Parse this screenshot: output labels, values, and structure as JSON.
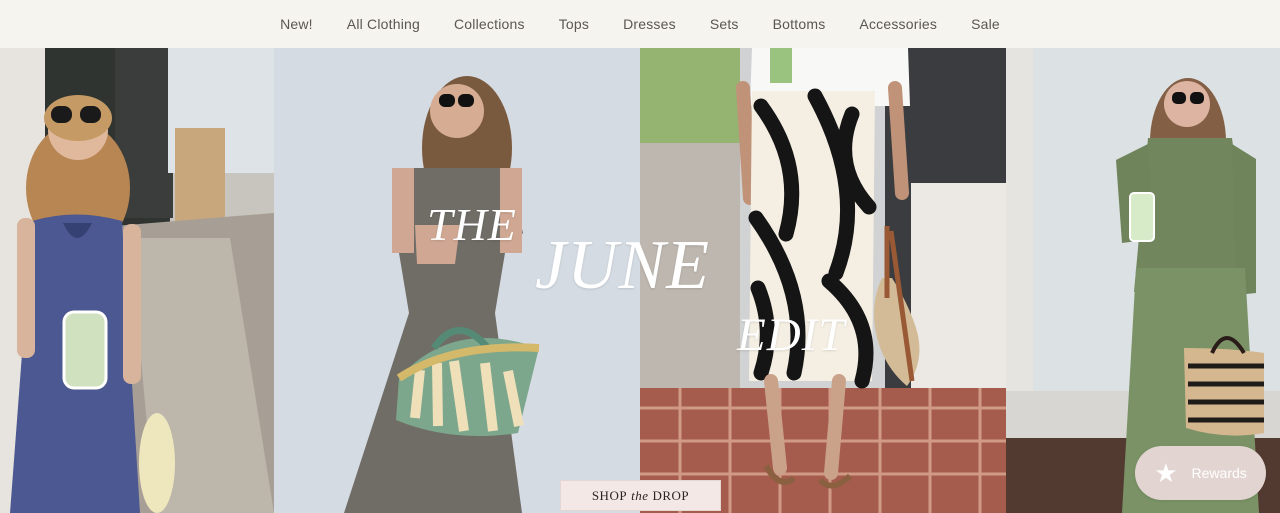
{
  "nav": {
    "items": [
      "New!",
      "All Clothing",
      "Collections",
      "Tops",
      "Dresses",
      "Sets",
      "Bottoms",
      "Accessories",
      "Sale"
    ]
  },
  "hero": {
    "title_line1": "THE",
    "title_line2": "JUNE",
    "title_line3": "EDIT",
    "cta": {
      "part1": "SHOP",
      "part2": "the",
      "part3": "DROP"
    },
    "panels": [
      {
        "alt": "woman in blue twist-front jumpsuit holding a green drink"
      },
      {
        "alt": "woman in gray v-neck jumpsuit holding green woven tote"
      },
      {
        "alt": "black and cream palm print midi skirt with sandals"
      },
      {
        "alt": "woman in sage green long-sleeve set holding striped tote"
      }
    ]
  },
  "rewards": {
    "label": "Rewards",
    "icon": "star-icon"
  },
  "colors": {
    "nav_bg": "#f6f4ef",
    "nav_text": "#5a5753",
    "cta_bg": "#f3e8e6",
    "rewards_bg": "#e2d5d1"
  }
}
